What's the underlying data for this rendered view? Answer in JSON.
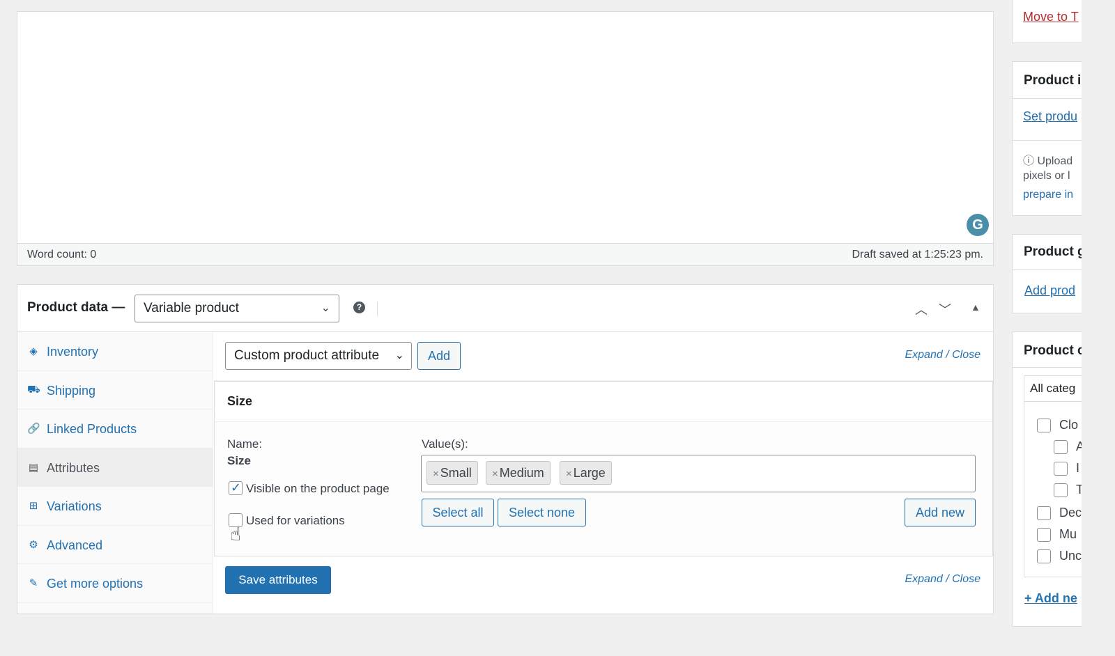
{
  "editor": {
    "word_count": "Word count: 0",
    "draft_saved": "Draft saved at 1:25:23 pm.",
    "grammarly_glyph": "G"
  },
  "product_data": {
    "title": "Product data —",
    "type_select": "Variable product",
    "help": "?",
    "tabs": [
      {
        "label": "Inventory",
        "icon": "tag-icon",
        "glyph": "◈"
      },
      {
        "label": "Shipping",
        "icon": "truck-icon",
        "glyph": "⛟"
      },
      {
        "label": "Linked Products",
        "icon": "link-icon",
        "glyph": "🔗"
      },
      {
        "label": "Attributes",
        "icon": "list-icon",
        "glyph": "▤",
        "active": true
      },
      {
        "label": "Variations",
        "icon": "grid-icon",
        "glyph": "⊞"
      },
      {
        "label": "Advanced",
        "icon": "gear-icon",
        "glyph": "⚙"
      },
      {
        "label": "Get more options",
        "icon": "plug-icon",
        "glyph": "✎"
      }
    ],
    "controls": {
      "up": "︿",
      "down": "﹀",
      "toggle": "▲"
    }
  },
  "attributes": {
    "attribute_select": "Custom product attribute",
    "add_label": "Add",
    "expand": "Expand",
    "slash": "/",
    "close": "Close",
    "attribute_heading": "Size",
    "name_label": "Name:",
    "name_value": "Size",
    "values_label": "Value(s):",
    "values": [
      "Small",
      "Medium",
      "Large"
    ],
    "visible_label": "Visible on the product page",
    "visible_checked": true,
    "variations_label": "Used for variations",
    "variations_checked": false,
    "select_all": "Select all",
    "select_none": "Select none",
    "add_new": "Add new",
    "save": "Save attributes"
  },
  "sidebar": {
    "move_to_trash": "Move to T",
    "image_box_title": "Product i",
    "set_image_link": "Set produ",
    "upload_note_1": "ⓘ Upload",
    "upload_note_2": "pixels or l",
    "upload_note_3": "prepare in",
    "gallery_title": "Product g",
    "add_gallery_link": "Add prod",
    "categories_title": "Product c",
    "categories_tab": "All categ",
    "categories": [
      "Clo",
      "A",
      "I",
      "T",
      "Dec",
      "Mu",
      "Unc"
    ],
    "add_new_category": "+ Add ne"
  }
}
